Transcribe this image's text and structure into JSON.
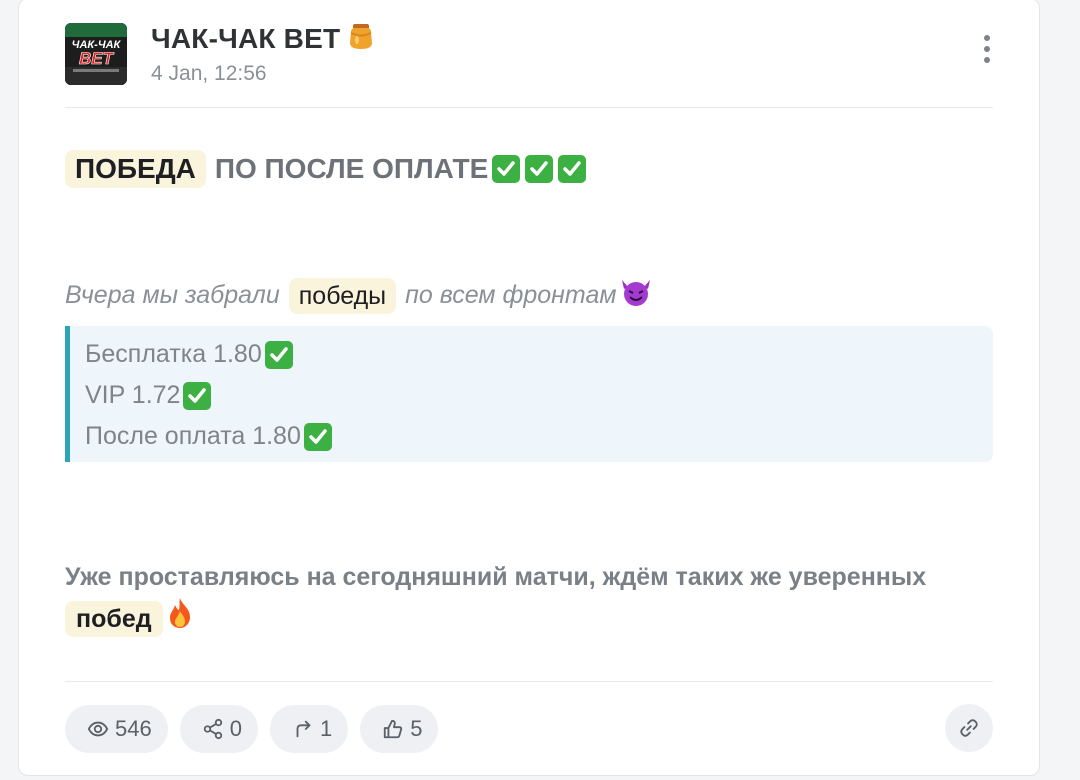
{
  "post": {
    "channel_name": "ЧАК-ЧАК BET",
    "date": "4 Jan, 12:56",
    "avatar": {
      "top_text": "ЧАК-ЧАК",
      "bottom_text": "BET"
    }
  },
  "message": {
    "headline_highlight": "ПОБЕДА",
    "headline_rest": "ПО ПОСЛЕ ОПЛАТЕ",
    "headline_checks": 3,
    "italic_before": "Вчера мы забрали",
    "italic_highlight": "победы",
    "italic_after": "по всем фронтам",
    "quote_lines": [
      "Бесплатка 1.80",
      "VIP 1.72",
      "После оплата 1.80"
    ],
    "bottom_line1": "Уже проставляюсь на сегодняшний матчи, ждём таких же уверенных",
    "bottom_highlight": "побед"
  },
  "stats": {
    "views": "546",
    "shares": "0",
    "forwards": "1",
    "likes": "5"
  },
  "colors": {
    "highlight_bg": "#fbf4dd",
    "quote_border": "#2ba5b8",
    "quote_bg": "#eef5fb",
    "check_green": "#3cb043"
  },
  "icons": {
    "more": "more-vertical-icon",
    "views": "eye-icon",
    "shares": "share-icon",
    "forwards": "forward-arrow-icon",
    "likes": "thumbs-up-icon",
    "link": "link-icon"
  }
}
